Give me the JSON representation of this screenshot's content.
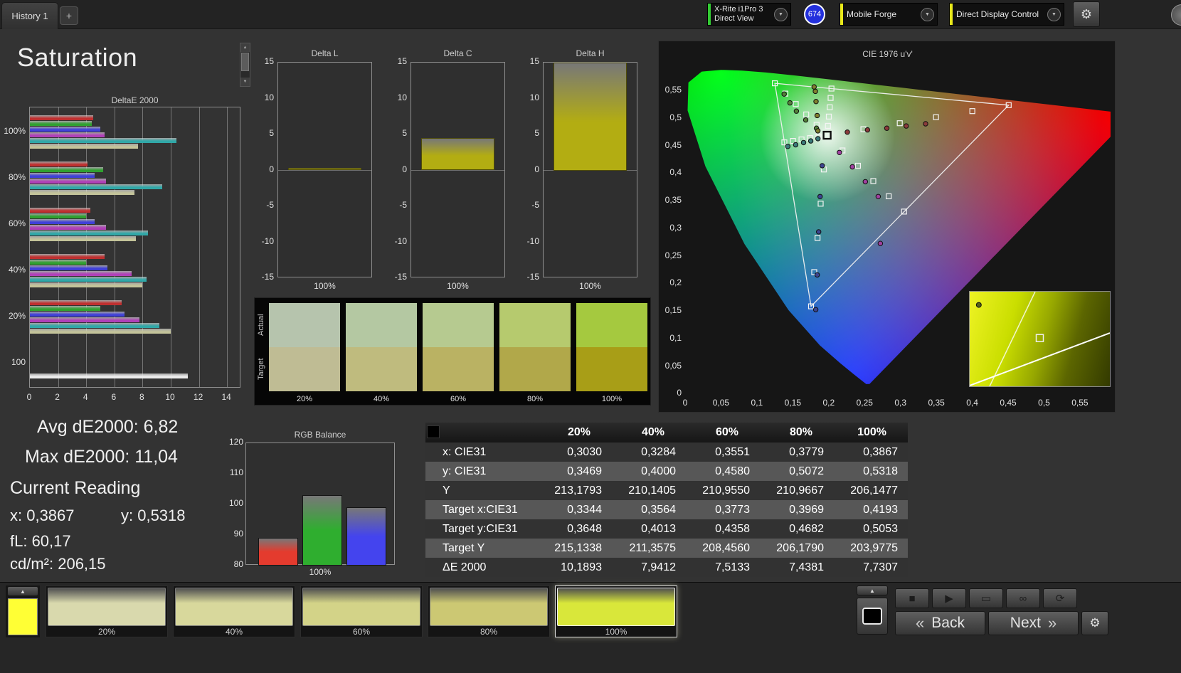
{
  "topbar": {
    "tab": "History 1",
    "add_tab": "+",
    "meters": {
      "device": {
        "line1": "X-Rite i1Pro 3",
        "line2": "Direct View",
        "accent": "#33cc33"
      },
      "count_badge": "674",
      "source": {
        "label": "Mobile Forge",
        "accent": "#e8e81a"
      },
      "display": {
        "label": "Direct Display Control",
        "accent": "#e8e81a"
      }
    }
  },
  "page_title": "Saturation",
  "readings": {
    "avg": "Avg dE2000: 6,82",
    "max": "Max dE2000: 11,04",
    "current_title": "Current Reading",
    "x": "x: 0,3867",
    "y": "y: 0,5318",
    "fl": "fL: 60,17",
    "cdm2": "cd/m²: 206,15"
  },
  "table": {
    "col_headers": [
      "20%",
      "40%",
      "60%",
      "80%",
      "100%"
    ],
    "rows": [
      {
        "label": "x: CIE31",
        "values": [
          "0,3030",
          "0,3284",
          "0,3551",
          "0,3779",
          "0,3867"
        ]
      },
      {
        "label": "y: CIE31",
        "values": [
          "0,3469",
          "0,4000",
          "0,4580",
          "0,5072",
          "0,5318"
        ]
      },
      {
        "label": "Y",
        "values": [
          "213,1793",
          "210,1405",
          "210,9550",
          "210,9667",
          "206,1477"
        ]
      },
      {
        "label": "Target x:CIE31",
        "values": [
          "0,3344",
          "0,3564",
          "0,3773",
          "0,3969",
          "0,4193"
        ]
      },
      {
        "label": "Target y:CIE31",
        "values": [
          "0,3648",
          "0,4013",
          "0,4358",
          "0,4682",
          "0,5053"
        ]
      },
      {
        "label": "Target Y",
        "values": [
          "215,1338",
          "211,3575",
          "208,4560",
          "206,1790",
          "203,9775"
        ]
      },
      {
        "label": "ΔE 2000",
        "values": [
          "10,1893",
          "7,9412",
          "7,5133",
          "7,4381",
          "7,7307"
        ]
      }
    ]
  },
  "swatches": {
    "row_labels": [
      "Actual",
      "Target"
    ],
    "labels": [
      "20%",
      "40%",
      "60%",
      "80%",
      "100%"
    ],
    "actual": [
      "#b6c4ad",
      "#b4c8a2",
      "#b6ca90",
      "#b6ca6e",
      "#a5c93f"
    ],
    "target": [
      "#bfbc94",
      "#bfbb7e",
      "#bab263",
      "#b1a84a",
      "#a89e17"
    ]
  },
  "chart_data": [
    {
      "id": "deltae2000",
      "type": "bar",
      "orientation": "horizontal",
      "title": "DeltaE 2000",
      "groups": [
        "100%",
        "80%",
        "60%",
        "40%",
        "20%",
        "100"
      ],
      "series_colors": [
        "#c03030",
        "#30a030",
        "#4040d8",
        "#b040b8",
        "#30a8a8",
        "#c4c49a"
      ],
      "luminance_color": "#ececec",
      "values": [
        [
          4.5,
          4.4,
          5.0,
          5.3,
          10.4,
          7.7
        ],
        [
          4.1,
          5.2,
          4.6,
          5.4,
          9.4,
          7.4
        ],
        [
          4.3,
          4.0,
          4.6,
          5.4,
          8.4,
          7.5
        ],
        [
          5.3,
          4.0,
          5.5,
          7.2,
          8.3,
          8.0
        ],
        [
          6.5,
          5.0,
          6.7,
          7.8,
          9.2,
          10.0
        ],
        [
          11.2
        ]
      ],
      "xlim": [
        0,
        15
      ],
      "xticks": [
        "0",
        "2",
        "4",
        "6",
        "8",
        "10",
        "12",
        "14"
      ]
    },
    {
      "id": "delta_l",
      "type": "bar",
      "title": "Delta L",
      "categories": [
        "100%"
      ],
      "values": [
        0.3
      ],
      "ylim": [
        -15,
        15
      ],
      "yticks": [
        15,
        10,
        5,
        0,
        -5,
        -10,
        -15
      ],
      "bar_color": "#b3ad12"
    },
    {
      "id": "delta_c",
      "type": "bar",
      "title": "Delta C",
      "categories": [
        "100%"
      ],
      "values": [
        4.5
      ],
      "ylim": [
        -15,
        15
      ],
      "yticks": [
        15,
        10,
        5,
        0,
        -5,
        -10,
        -15
      ],
      "bar_color": "#b3ad12"
    },
    {
      "id": "delta_h",
      "type": "bar",
      "title": "Delta H",
      "categories": [
        "100%"
      ],
      "values": [
        15
      ],
      "ylim": [
        -15,
        15
      ],
      "yticks": [
        15,
        10,
        5,
        0,
        -5,
        -10,
        -15
      ],
      "bar_color": "#b3ad12"
    },
    {
      "id": "rgb_balance",
      "type": "bar",
      "title": "RGB Balance",
      "categories": [
        "100%"
      ],
      "series": [
        {
          "name": "red",
          "value": 89,
          "color": "#e43b2e"
        },
        {
          "name": "green",
          "value": 103,
          "color": "#2fae2f"
        },
        {
          "name": "blue",
          "value": 99,
          "color": "#4444ee"
        }
      ],
      "ylim": [
        80,
        120
      ],
      "yticks": [
        120,
        110,
        100,
        90,
        80
      ]
    },
    {
      "id": "cie",
      "type": "scatter",
      "title": "CIE 1976 u'v'",
      "xticks": [
        "0",
        "0,05",
        "0,1",
        "0,15",
        "0,2",
        "0,25",
        "0,3",
        "0,35",
        "0,4",
        "0,45",
        "0,5",
        "0,55"
      ],
      "yticks": [
        "0,55",
        "0,5",
        "0,45",
        "0,4",
        "0,35",
        "0,3",
        "0,25",
        "0,2",
        "0,15",
        "0,1",
        "0,05",
        "0"
      ],
      "gamut_triangle": [
        [
          0.4507,
          0.5229
        ],
        [
          0.125,
          0.5625
        ],
        [
          0.1754,
          0.1579
        ]
      ],
      "white_point": [
        0.1978,
        0.4683
      ],
      "sweep_colors": {
        "red": "#8a3a3a",
        "green": "#54803a",
        "blue": "#3c4490",
        "cyan": "#3a7a7a",
        "magenta": "#a040a0",
        "yellow": "#80802e"
      },
      "targets": {
        "red": [
          [
            0.2484,
            0.4792
          ],
          [
            0.299,
            0.4901
          ],
          [
            0.3495,
            0.501
          ],
          [
            0.4001,
            0.512
          ],
          [
            0.4507,
            0.5229
          ]
        ],
        "green": [
          [
            0.1832,
            0.4871
          ],
          [
            0.1687,
            0.506
          ],
          [
            0.1541,
            0.5248
          ],
          [
            0.1396,
            0.5437
          ],
          [
            0.125,
            0.5625
          ]
        ],
        "blue": [
          [
            0.1933,
            0.4062
          ],
          [
            0.1888,
            0.3441
          ],
          [
            0.1844,
            0.282
          ],
          [
            0.1799,
            0.22
          ],
          [
            0.1754,
            0.1579
          ]
        ],
        "cyan": [
          [
            0.1859,
            0.4657
          ],
          [
            0.174,
            0.4631
          ],
          [
            0.1621,
            0.4606
          ],
          [
            0.1502,
            0.458
          ],
          [
            0.1383,
            0.4554
          ]
        ],
        "magenta": [
          [
            0.2192,
            0.4406
          ],
          [
            0.2407,
            0.4129
          ],
          [
            0.2621,
            0.3852
          ],
          [
            0.2836,
            0.3575
          ],
          [
            0.305,
            0.3298
          ]
        ],
        "yellow": [
          [
            0.199,
            0.4852
          ],
          [
            0.2002,
            0.5021
          ],
          [
            0.2015,
            0.519
          ],
          [
            0.2027,
            0.536
          ],
          [
            0.2039,
            0.5529
          ]
        ]
      },
      "measured": {
        "red": [
          [
            0.226,
            0.474
          ],
          [
            0.254,
            0.478
          ],
          [
            0.281,
            0.481
          ],
          [
            0.308,
            0.485
          ],
          [
            0.335,
            0.489
          ]
        ],
        "green": [
          [
            0.183,
            0.481
          ],
          [
            0.168,
            0.496
          ],
          [
            0.155,
            0.512
          ],
          [
            0.146,
            0.527
          ],
          [
            0.138,
            0.543
          ]
        ],
        "blue": [
          [
            0.191,
            0.413
          ],
          [
            0.188,
            0.357
          ],
          [
            0.186,
            0.293
          ],
          [
            0.184,
            0.215
          ],
          [
            0.182,
            0.152
          ]
        ],
        "cyan": [
          [
            0.185,
            0.462
          ],
          [
            0.175,
            0.458
          ],
          [
            0.165,
            0.455
          ],
          [
            0.154,
            0.451
          ],
          [
            0.143,
            0.448
          ]
        ],
        "magenta": [
          [
            0.215,
            0.437
          ],
          [
            0.233,
            0.411
          ],
          [
            0.251,
            0.384
          ],
          [
            0.269,
            0.357
          ],
          [
            0.272,
            0.272
          ]
        ],
        "yellow": [
          [
            0.1849,
            0.4762
          ],
          [
            0.1839,
            0.504
          ],
          [
            0.1824,
            0.5294
          ],
          [
            0.1815,
            0.5479
          ],
          [
            0.1797,
            0.556
          ]
        ]
      },
      "inset": {
        "square": [
          0.5,
          0.49
        ],
        "dot": [
          0.065,
          0.14
        ]
      }
    }
  ],
  "bottom": {
    "current_swatch_color": "#ffff35",
    "patches": [
      {
        "label": "20%",
        "color": "#d9d9ad"
      },
      {
        "label": "40%",
        "color": "#d8d89c"
      },
      {
        "label": "60%",
        "color": "#d3d388"
      },
      {
        "label": "80%",
        "color": "#ccc873"
      },
      {
        "label": "100%",
        "color": "#d9e73a",
        "selected": true
      }
    ],
    "back_label": "Back",
    "next_label": "Next"
  },
  "icons": {
    "dropdown": "▼",
    "gear": "⚙",
    "up_arrow": "▲",
    "down_arrow": "▼",
    "stop": "■",
    "play": "▶",
    "pattern": "▭",
    "loop": "∞",
    "refresh": "⟳",
    "back_chevron": "«",
    "next_chevron": "»"
  }
}
